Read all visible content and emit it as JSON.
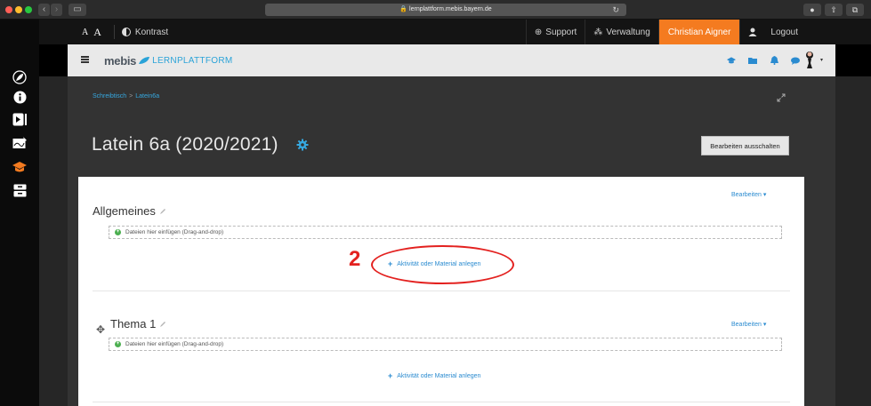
{
  "browser": {
    "url": "lernplattform.mebis.bayern.de"
  },
  "utility_bar": {
    "font_small": "A",
    "font_large": "A",
    "contrast_label": "Kontrast",
    "support_label": "Support",
    "admin_label": "Verwaltung",
    "user_name": "Christian Aigner",
    "logout_label": "Logout"
  },
  "nav": {
    "logo_text": "mebis",
    "logo_subtext": "LERNPLATTFORM"
  },
  "breadcrumb": {
    "items": [
      "Schreibtisch",
      "Latein6a"
    ],
    "separator": ">"
  },
  "page": {
    "title": "Latein 6a (2020/2021)",
    "edit_off_button": "Bearbeiten ausschalten"
  },
  "sections": [
    {
      "title": "Allgemeines",
      "edit_link": "Bearbeiten",
      "dropzone": "Dateien hier einfügen (Drag-and-drop)",
      "add_activity": "Aktivität oder Material anlegen"
    },
    {
      "title": "Thema 1",
      "edit_link": "Bearbeiten",
      "dropzone": "Dateien hier einfügen (Drag-and-drop)",
      "add_activity": "Aktivität oder Material anlegen"
    }
  ],
  "annotation": {
    "number": "2"
  },
  "colors": {
    "accent_blue": "#2a8bd0",
    "user_orange": "#f47b20",
    "annotation_red": "#e3211f"
  }
}
